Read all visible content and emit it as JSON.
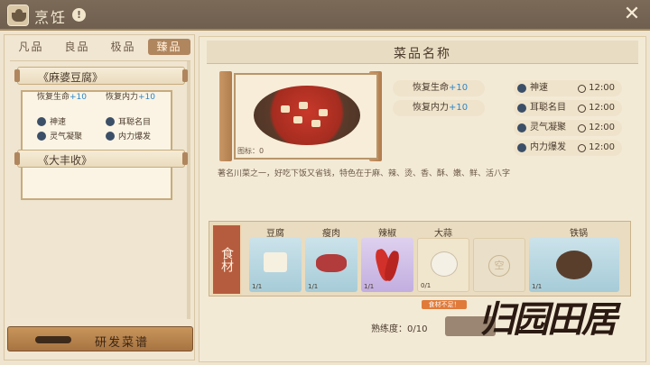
{
  "header": {
    "title": "烹饪"
  },
  "tabs": [
    {
      "label": "凡品",
      "active": false
    },
    {
      "label": "良品",
      "active": false
    },
    {
      "label": "极品",
      "active": false
    },
    {
      "label": "臻品",
      "active": true
    }
  ],
  "recipes": [
    {
      "name": "《麻婆豆腐》",
      "stats": [
        {
          "label": "恢复生命",
          "value": "+10"
        },
        {
          "label": "恢复内力",
          "value": "+10"
        }
      ],
      "buffs": [
        "神速",
        "耳聪名目",
        "灵气凝聚",
        "内力爆发"
      ]
    },
    {
      "name": "《大丰收》"
    }
  ],
  "research_button": {
    "label": "研发菜谱"
  },
  "dish": {
    "title": "菜品名称",
    "image_label": "图标：0",
    "effects": [
      {
        "label": "恢复生命",
        "value": "+10"
      },
      {
        "label": "恢复内力",
        "value": "+10"
      }
    ],
    "buffs": [
      {
        "name": "神速",
        "time": "12:00"
      },
      {
        "name": "耳聪名目",
        "time": "12:00"
      },
      {
        "name": "灵气凝聚",
        "time": "12:00"
      },
      {
        "name": "内力爆发",
        "time": "12:00"
      }
    ],
    "description": "著名川菜之一，好吃下饭又省钱，特色在于麻、辣、烫、香、酥、嫩、鲜、活八字"
  },
  "ingredients": {
    "label": "食材",
    "items": [
      {
        "name": "豆腐",
        "count": "1/1"
      },
      {
        "name": "瘦肉",
        "count": "1/1"
      },
      {
        "name": "辣椒",
        "count": "1/1"
      },
      {
        "name": "大蒜",
        "count": "0/1"
      },
      {
        "name": "",
        "empty_mark": "空"
      },
      {
        "name": "铁锅",
        "count": "1/1"
      }
    ],
    "warning": "食材不足！"
  },
  "proficiency": {
    "text": "熟练度：0/10"
  },
  "watermark": "归园田居",
  "colors": {
    "accent": "#b0865f",
    "stat_blue": "#2c86c9",
    "warning": "#e07a3a"
  }
}
